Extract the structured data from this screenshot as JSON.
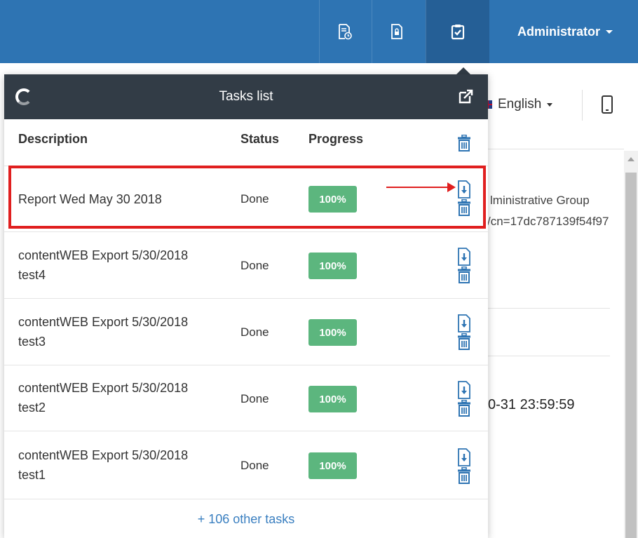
{
  "topbar": {
    "icons": [
      "report-history-icon",
      "lock-document-icon",
      "tasks-check-icon"
    ],
    "user": "Administrator"
  },
  "background": {
    "language": "English",
    "text1": "lministrative Group",
    "text2": "/cn=17dc787139f54f97",
    "text3": "0-31 23:59:59"
  },
  "tasks": {
    "title": "Tasks list",
    "columns": {
      "description": "Description",
      "status": "Status",
      "progress": "Progress"
    },
    "rows": [
      {
        "desc1": "Report Wed May 30 2018",
        "desc2": "",
        "status": "Done",
        "progress": "100%"
      },
      {
        "desc1": "contentWEB Export 5/30/2018",
        "desc2": "test4",
        "status": "Done",
        "progress": "100%"
      },
      {
        "desc1": "contentWEB Export 5/30/2018",
        "desc2": "test3",
        "status": "Done",
        "progress": "100%"
      },
      {
        "desc1": "contentWEB Export 5/30/2018",
        "desc2": "test2",
        "status": "Done",
        "progress": "100%"
      },
      {
        "desc1": "contentWEB Export 5/30/2018",
        "desc2": "test1",
        "status": "Done",
        "progress": "100%"
      }
    ],
    "more": "+ 106 other tasks"
  },
  "colors": {
    "topbar": "#2e74b3",
    "header": "#323c46",
    "progress": "#5cb67e",
    "highlight": "#e01f1f",
    "icon": "#2e74b3"
  }
}
